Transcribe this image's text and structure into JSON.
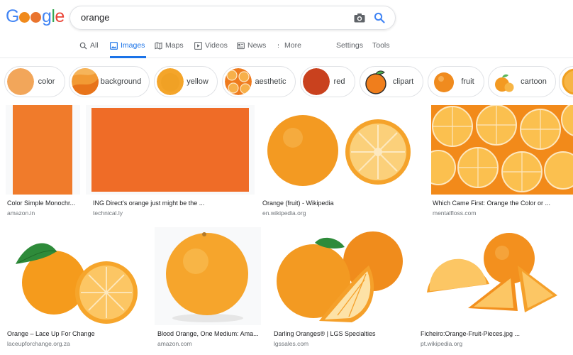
{
  "search": {
    "query": "orange"
  },
  "tabs": [
    {
      "label": "All",
      "icon": "search-icon"
    },
    {
      "label": "Images",
      "icon": "image-icon",
      "active": true
    },
    {
      "label": "Maps",
      "icon": "map-icon"
    },
    {
      "label": "Videos",
      "icon": "play-icon"
    },
    {
      "label": "News",
      "icon": "news-icon"
    },
    {
      "label": "More",
      "icon": "more-vert-icon"
    },
    {
      "label": "Settings"
    },
    {
      "label": "Tools"
    }
  ],
  "chips": [
    {
      "label": "color",
      "swatch": "#f2a65a"
    },
    {
      "label": "background",
      "swatch": "#f08a1c"
    },
    {
      "label": "yellow",
      "swatch": "#f4a52a"
    },
    {
      "label": "aesthetic",
      "swatch": "#ef7b1e"
    },
    {
      "label": "red",
      "swatch": "#c9411e"
    },
    {
      "label": "clipart",
      "swatch": "#f07e1c"
    },
    {
      "label": "fruit",
      "swatch": "#f08b1e"
    },
    {
      "label": "cartoon",
      "swatch": "#f39a22"
    }
  ],
  "results_row1": [
    {
      "title": "Color Simple Monochr...",
      "source": "amazon.in",
      "color": "#f07b2b"
    },
    {
      "title": "ING Direct's orange just might be the ...",
      "source": "technical.ly",
      "color": "#ef6c27"
    },
    {
      "title": "Orange (fruit) - Wikipedia",
      "source": "en.wikipedia.org",
      "color": "#f39a22"
    },
    {
      "title": "Which Came First: Orange the Color or ...",
      "source": "mentalfloss.com",
      "color": "#f28a1a"
    }
  ],
  "results_row2": [
    {
      "title": "Orange – Lace Up For Change",
      "source": "laceupforchange.org.za",
      "color": "#f59b1c"
    },
    {
      "title": "Blood Orange, One Medium: Ama...",
      "source": "amazon.com",
      "color": "#f6a52c"
    },
    {
      "title": "Darling Oranges® | LGS Specialties",
      "source": "lgssales.com",
      "color": "#f08c1c"
    },
    {
      "title": "Ficheiro:Orange-Fruit-Pieces.jpg ...",
      "source": "pt.wikipedia.org",
      "color": "#f3901e"
    }
  ],
  "colors": {
    "accent": "#1a73e8",
    "orange": "#f28a1a"
  }
}
